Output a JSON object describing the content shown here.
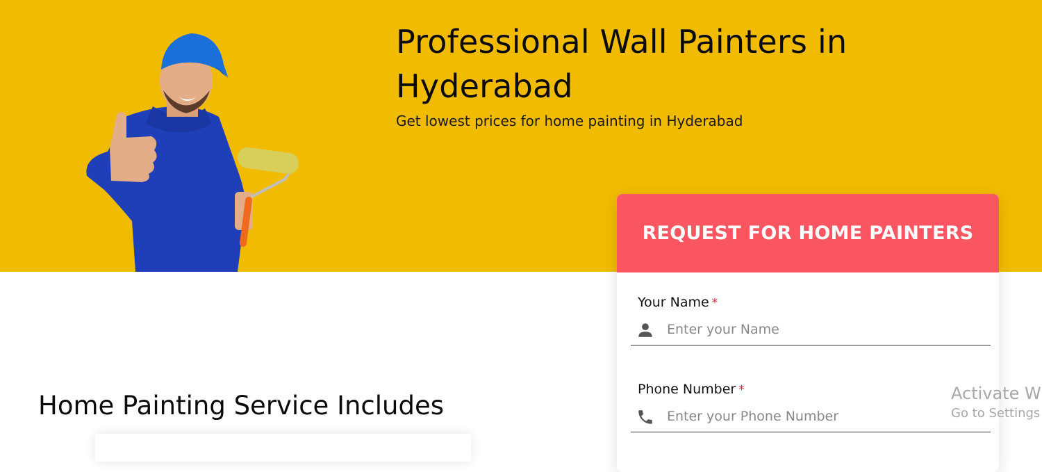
{
  "hero": {
    "title": "Professional Wall Painters in Hyderabad",
    "subtitle": "Get lowest prices for home painting in Hyderabad",
    "background_color": "#f1bb02"
  },
  "form": {
    "title": "REQUEST FOR HOME PAINTERS",
    "header_color": "#fa5661",
    "fields": [
      {
        "label": "Your Name",
        "required_mark": "*",
        "placeholder": "Enter your Name",
        "icon": "person-icon"
      },
      {
        "label": "Phone Number",
        "required_mark": "*",
        "placeholder": "Enter your Phone Number",
        "icon": "phone-icon"
      }
    ]
  },
  "services": {
    "title": "Home Painting Service Includes"
  },
  "watermark": {
    "title": "Activate Wi",
    "subtitle": "Go to Settings"
  }
}
